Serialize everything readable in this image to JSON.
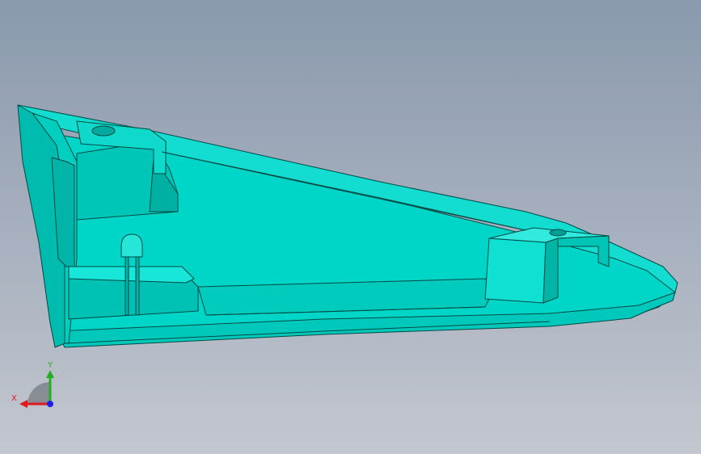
{
  "viewport": {
    "background_top": "#8a99ad",
    "background_bottom": "#c3c7cf"
  },
  "model": {
    "face_color": "#00e0d0",
    "shade_color": "#00b8aa",
    "dark_color": "#00978c",
    "edge_color": "#004a44"
  },
  "triad": {
    "x_label": "X",
    "y_label": "Y",
    "x_color": "#e0191b",
    "y_color": "#20b020",
    "z_color": "#1e1ee6"
  }
}
